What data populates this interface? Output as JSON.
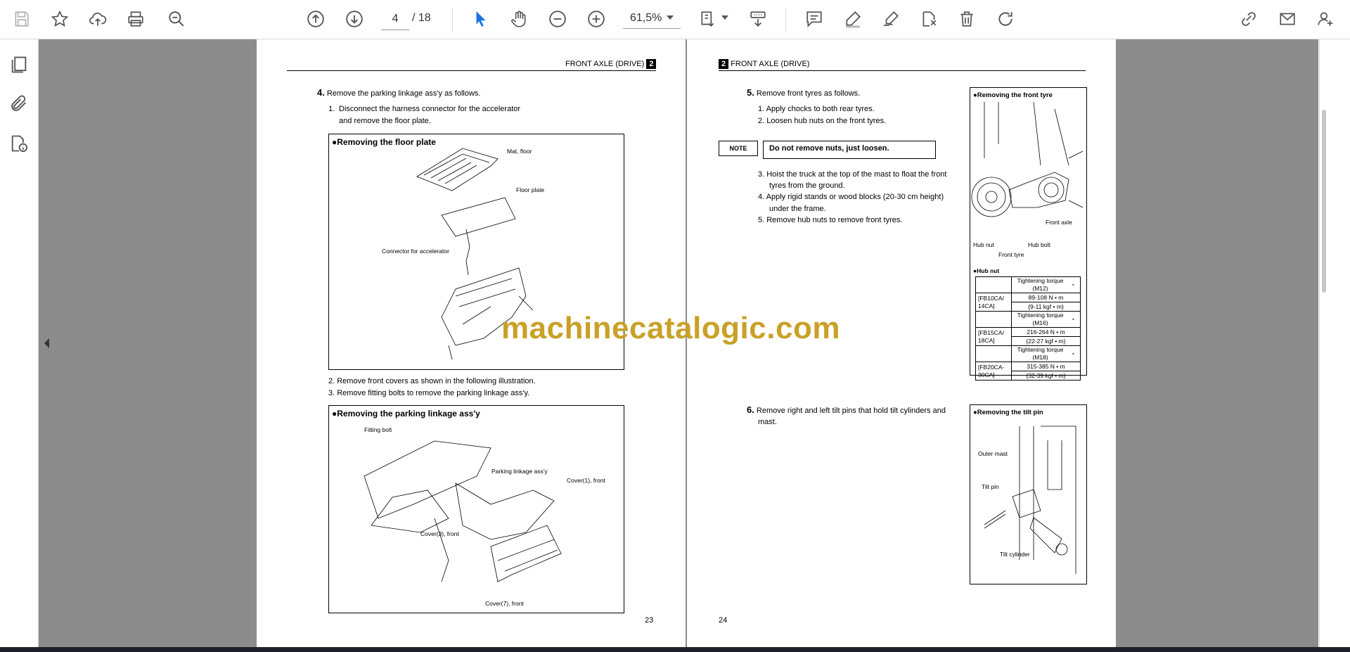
{
  "toolbar": {
    "left_icons": [
      "save-icon",
      "star-icon",
      "cloud-upload-icon",
      "print-icon",
      "zoom-search-icon"
    ],
    "nav_icons": [
      "page-up-icon",
      "page-down-icon"
    ],
    "current_page": "4",
    "total_pages": "/ 18",
    "tools": [
      "select-cursor-icon",
      "hand-icon",
      "zoom-out-icon",
      "zoom-in-icon"
    ],
    "zoom": "61,5%",
    "right_icons": [
      "fit-page-icon",
      "scroll-mode-icon",
      "comment-icon",
      "highlight-icon",
      "sign-icon",
      "stamp-icon",
      "delete-icon",
      "rotate-icon",
      "share-icon",
      "email-icon",
      "account-icon"
    ]
  },
  "left_rail": {
    "icons": [
      "pages-icon",
      "attachment-icon",
      "document-info-icon"
    ]
  },
  "watermark": "machinecatalogic.com",
  "page_left": {
    "header": "FRONT AXLE (DRIVE)",
    "chapter": "2",
    "step4_num": "4.",
    "step4_text": "Remove the parking linkage ass'y as follows.",
    "sub1_num": "1.",
    "sub1_text_a": "Disconnect the harness connector for the accelerator",
    "sub1_text_b": "and remove the floor plate.",
    "fig1_title": "●Removing the floor plate",
    "fig1_labels": {
      "mat": "Mat, floor",
      "plate": "Floor plate",
      "connector": "Connector for accelerator"
    },
    "sub2": "2.  Remove front covers as shown in the following illustration.",
    "sub3": "3.  Remove fitting bolts to remove the parking linkage ass'y.",
    "fig2_title": "●Removing the parking linkage ass'y",
    "fig2_labels": {
      "bolt": "Fitting bolt",
      "linkage": "Parking linkage ass'y",
      "cover1": "Cover(1), front",
      "cover3": "Cover(3), front",
      "cover7": "Cover(7), front"
    },
    "page_number": "23"
  },
  "page_right": {
    "header": "FRONT AXLE (DRIVE)",
    "chapter": "2",
    "step5_num": "5.",
    "step5_text": "Remove front tyres as follows.",
    "s1": "1.  Apply chocks to both rear tyres.",
    "s2": "2.  Loosen hub nuts on the front tyres.",
    "note_label": "NOTE",
    "note_text": "Do not remove nuts, just loosen.",
    "s3a": "3.  Hoist the truck at the top of the mast to float the front",
    "s3b": "tyres from the ground.",
    "s4a": "4.  Apply rigid stands or wood blocks (20-30 cm height)",
    "s4b": "under the frame.",
    "s5": "5.  Remove hub nuts to remove front tyres.",
    "fig3_title": "●Removing the front tyre",
    "fig3_labels": {
      "axle": "Front axle",
      "hubnut": "Hub nut",
      "hubbolt": "Hub bolt",
      "tyre": "Front tyre"
    },
    "hubnut_title": "●Hub nut",
    "torque_rows": [
      {
        "header": "Tightening torque (M12)",
        "model": "[FB10CA/ 14CA]",
        "nm": "89-108 N • m",
        "kgf": "{9-11 kgf • m}"
      },
      {
        "header": "Tightening torque (M16)",
        "model": "[FB15CA/ 18CA]",
        "nm": "216-264 N • m",
        "kgf": "{22-27 kgf • m}"
      },
      {
        "header": "Tightening torque (M18)",
        "model": "[FB20CA- 30CA]",
        "nm": "315-385 N • m",
        "kgf": "{32-39 kgf • m}"
      }
    ],
    "step6_num": "6.",
    "step6_text_a": "Remove right and left tilt pins that hold tilt cylinders and",
    "step6_text_b": "mast.",
    "fig4_title": "●Removing the tilt pin",
    "fig4_labels": {
      "mast": "Outer mast",
      "pin": "Tilt pin",
      "cyl": "Tilt cylinder"
    },
    "page_number": "24"
  }
}
